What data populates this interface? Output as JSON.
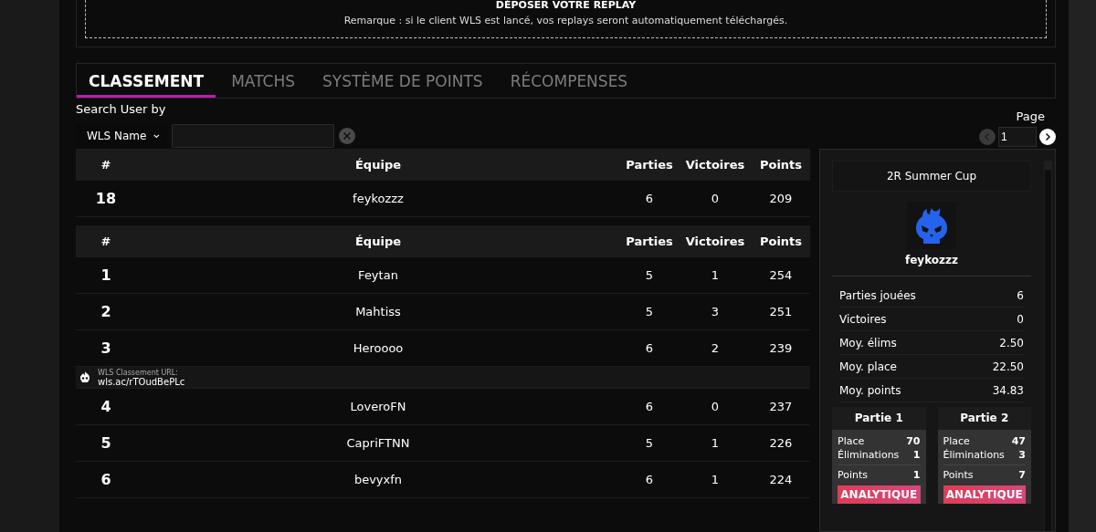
{
  "upload": {
    "title": "DÉPOSER VOTRE REPLAY",
    "note": "Remarque : si le client WLS est lancé, vos replays seront automatiquement téléchargés."
  },
  "tabs": [
    {
      "label": "CLASSEMENT",
      "selected": true
    },
    {
      "label": "MATCHS",
      "selected": false
    },
    {
      "label": "SYSTÈME DE POINTS",
      "selected": false
    },
    {
      "label": "RÉCOMPENSES",
      "selected": false
    }
  ],
  "search": {
    "label": "Search User by",
    "filter": "WLS Name"
  },
  "pager": {
    "label": "Page",
    "value": "1"
  },
  "own_columns": [
    "#",
    "Équipe",
    "Parties",
    "Victoires",
    "Points"
  ],
  "columns": [
    "#",
    "Équipe",
    "Parties",
    "Victoires",
    "Points"
  ],
  "own_row": {
    "rank": "18",
    "team": "feykozzz",
    "games": "6",
    "wins": "0",
    "points": "209"
  },
  "rows": [
    {
      "kind": "team",
      "rank": "1",
      "team": "Feytan",
      "games": "5",
      "wins": "1",
      "points": "254"
    },
    {
      "kind": "team",
      "rank": "2",
      "team": "Mahtiss",
      "games": "5",
      "wins": "3",
      "points": "251"
    },
    {
      "kind": "team",
      "rank": "3",
      "team": "Heroooo",
      "games": "6",
      "wins": "2",
      "points": "239"
    },
    {
      "kind": "banner",
      "label": "WLS Classement URL:",
      "url": "wls.ac/rTOudBePLc"
    },
    {
      "kind": "team",
      "rank": "4",
      "team": "LoveroFN",
      "games": "6",
      "wins": "0",
      "points": "237"
    },
    {
      "kind": "team",
      "rank": "5",
      "team": "CapriFTNN",
      "games": "5",
      "wins": "1",
      "points": "226"
    },
    {
      "kind": "team",
      "rank": "6",
      "team": "bevyxfn",
      "games": "6",
      "wins": "1",
      "points": "224"
    }
  ],
  "side": {
    "event": "2R Summer Cup",
    "player": "feykozzz",
    "stats": [
      {
        "label": "Parties jouées",
        "value": "6"
      },
      {
        "label": "Victoires",
        "value": "0"
      },
      {
        "label": "Moy. élims",
        "value": "2.50"
      },
      {
        "label": "Moy. place",
        "value": "22.50"
      },
      {
        "label": "Moy. points",
        "value": "34.83"
      }
    ],
    "games": [
      {
        "title": "Partie 1",
        "place_label": "Place",
        "place": "70",
        "elims_label": "Éliminations",
        "elims": "1",
        "points_label": "Points",
        "points": "1",
        "button": "ANALYTIQUE"
      },
      {
        "title": "Partie 2",
        "place_label": "Place",
        "place": "47",
        "elims_label": "Éliminations",
        "elims": "3",
        "points_label": "Points",
        "points": "7",
        "button": "ANALYTIQUE"
      }
    ]
  }
}
